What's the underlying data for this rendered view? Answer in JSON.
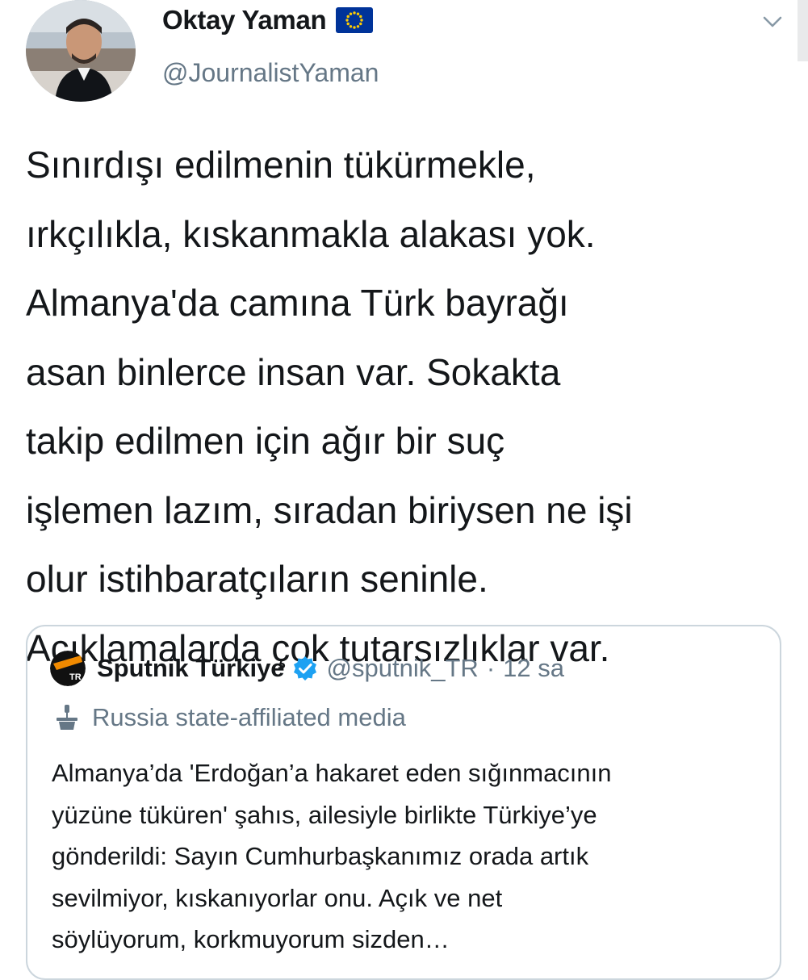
{
  "author": {
    "display_name": "Oktay Yaman",
    "flag_icon": "eu-flag-icon",
    "handle": "@JournalistYaman"
  },
  "menu": {
    "icon": "chevron-down-icon"
  },
  "tweet": {
    "lines": [
      "Sınırdışı edilmenin tükürmekle,",
      "ırkçılıkla, kıskanmakla alakası yok.",
      "Almanya'da camına Türk bayrağı",
      "asan binlerce insan var. Sokakta",
      "takip edilmen için ağır bir suç",
      "işlemen lazım, sıradan biriysen ne işi",
      "olur istihbaratçıların seninle.",
      "Açıklamalarda çok tutarsızlıklar var."
    ]
  },
  "quoted": {
    "logo_text": "TR",
    "display_name": "Sputnik Türkiye",
    "verified_icon": "verified-badge-icon",
    "handle": "@sputnik_TR",
    "separator": "·",
    "time": "12 sa",
    "label_icon": "podium-icon",
    "label": "Russia state-affiliated media",
    "lines": [
      "Almanya’da 'Erdoğan’a hakaret eden sığınmacının",
      "yüzüne tüküren' şahıs, ailesiyle birlikte Türkiye’ye",
      "gönderildi: Sayın Cumhurbaşkanımız orada artık",
      "sevilmiyor, kıskanıyorlar onu. Açık ve net",
      "söylüyorum, korkmuyorum sizden…"
    ]
  },
  "colors": {
    "text": "#14171a",
    "secondary": "#657786",
    "verified": "#1da1f2",
    "card_border": "#ccd6dd",
    "eu_blue": "#003399",
    "eu_star": "#ffcc00",
    "sputnik_orange": "#f18a00"
  }
}
